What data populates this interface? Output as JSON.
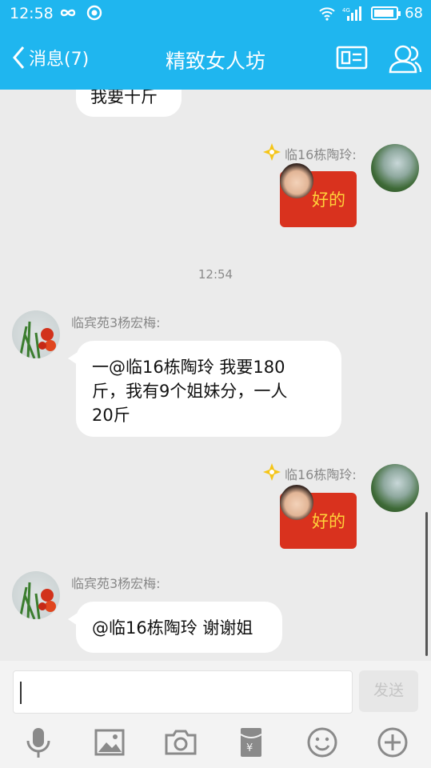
{
  "status_bar": {
    "time": "12:58",
    "battery": "68"
  },
  "header": {
    "back_label": "消息(7)",
    "title": "精致女人坊"
  },
  "messages": {
    "partial_text": "我要十斤",
    "msg1": {
      "sender": "临16栋陶玲:",
      "sticker_text": "好的"
    },
    "timestamp": "12:54",
    "msg2": {
      "sender": "临宾苑3杨宏梅:",
      "line1": "一@临16栋陶玲 我要180",
      "line2": "斤，我有9个姐妹分，一人",
      "line3": "20斤"
    },
    "msg3": {
      "sender": "临16栋陶玲:",
      "sticker_text": "好的"
    },
    "msg4": {
      "sender": "临宾苑3杨宏梅:",
      "text": "@临16栋陶玲 谢谢姐"
    }
  },
  "input": {
    "placeholder": "",
    "send_label": "发送"
  },
  "toolbar_icons": [
    "microphone-icon",
    "image-icon",
    "camera-icon",
    "red-envelope-icon",
    "emoji-icon",
    "plus-icon"
  ],
  "colors": {
    "header": "#1fb6ef",
    "sticker_red": "#d9321e",
    "sticker_text": "#ffd23a",
    "badge": "#f5c518"
  }
}
